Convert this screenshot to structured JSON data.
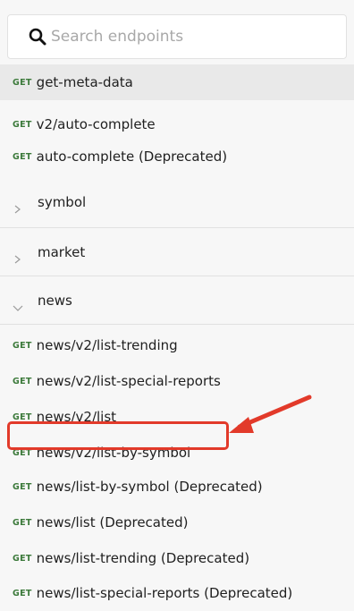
{
  "search": {
    "placeholder": "Search endpoints"
  },
  "top_endpoints": [
    {
      "method": "GET",
      "label": "get-meta-data"
    },
    {
      "method": "GET",
      "label": "v2/auto-complete"
    },
    {
      "method": "GET",
      "label": "auto-complete (Deprecated)"
    }
  ],
  "groups": [
    {
      "label": "symbol",
      "state": "collapsed"
    },
    {
      "label": "market",
      "state": "collapsed"
    },
    {
      "label": "news",
      "state": "expanded"
    }
  ],
  "news_endpoints": [
    {
      "method": "GET",
      "label": "news/v2/list-trending"
    },
    {
      "method": "GET",
      "label": "news/v2/list-special-reports"
    },
    {
      "method": "GET",
      "label": "news/v2/list"
    },
    {
      "method": "GET",
      "label": "news/v2/list-by-symbol"
    },
    {
      "method": "GET",
      "label": "news/list-by-symbol (Deprecated)"
    },
    {
      "method": "GET",
      "label": "news/list (Deprecated)"
    },
    {
      "method": "GET",
      "label": "news/list-trending (Deprecated)"
    },
    {
      "method": "GET",
      "label": "news/list-special-reports (Deprecated)"
    }
  ],
  "colors": {
    "method_green": "#3c7a3b",
    "selected_bg": "#e9e9e9",
    "annotation_red": "#e23a2a"
  }
}
